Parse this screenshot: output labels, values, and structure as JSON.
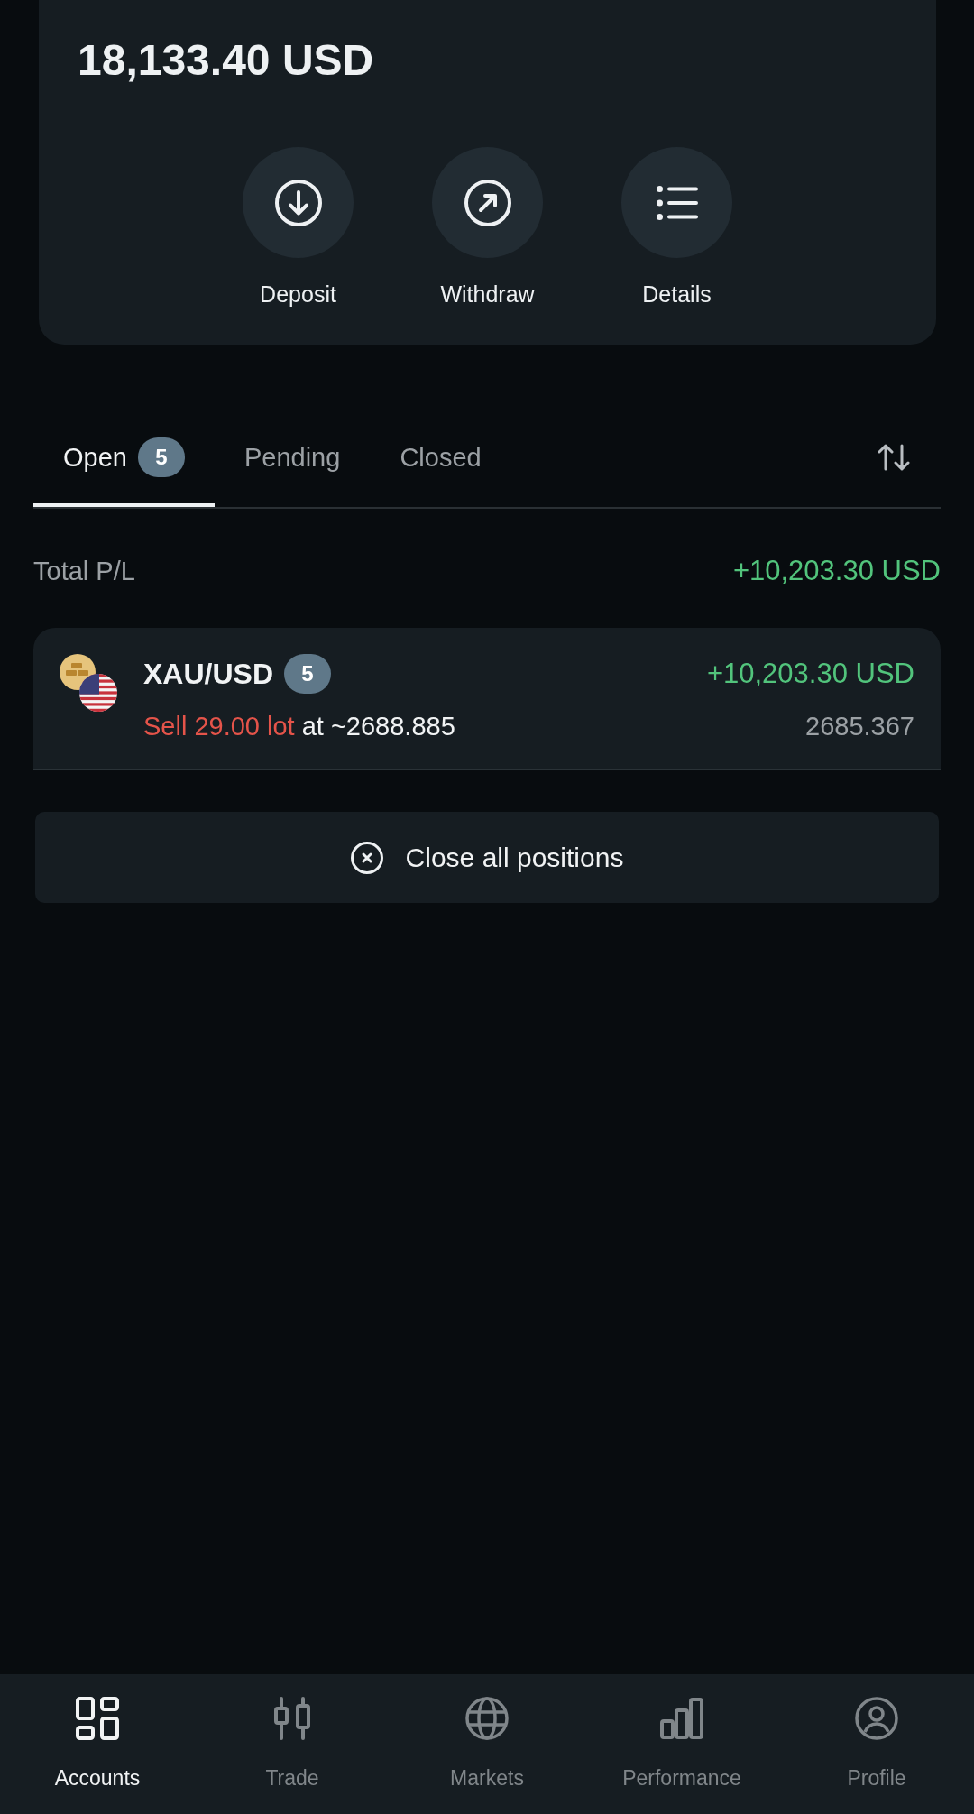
{
  "balance": {
    "amount": "18,133.40 USD",
    "actions": [
      {
        "kind": "deposit",
        "label": "Deposit"
      },
      {
        "kind": "withdraw",
        "label": "Withdraw"
      },
      {
        "kind": "details",
        "label": "Details"
      }
    ]
  },
  "tabs": [
    {
      "label": "Open",
      "count": "5",
      "selected": true
    },
    {
      "label": "Pending",
      "selected": false
    },
    {
      "label": "Closed",
      "selected": false
    }
  ],
  "total_pl": {
    "label": "Total P/L",
    "value": "+10,203.30 USD"
  },
  "positions": [
    {
      "kind": "sell",
      "symbol": "XAU/USD",
      "count": "5",
      "pl": "+10,203.30 USD",
      "order": "Sell 29.00 lot",
      "price": "at ~2688.885",
      "current": "2685.367"
    }
  ],
  "close_all_button": {
    "label": "Close all positions"
  },
  "bottom_nav": [
    {
      "kind": "accounts",
      "label": "Accounts",
      "selected": true
    },
    {
      "kind": "trade",
      "label": "Trade",
      "selected": false
    },
    {
      "kind": "markets",
      "label": "Markets",
      "selected": false
    },
    {
      "kind": "performance",
      "label": "Performance",
      "selected": false
    },
    {
      "kind": "profile",
      "label": "Profile",
      "selected": false
    }
  ]
}
